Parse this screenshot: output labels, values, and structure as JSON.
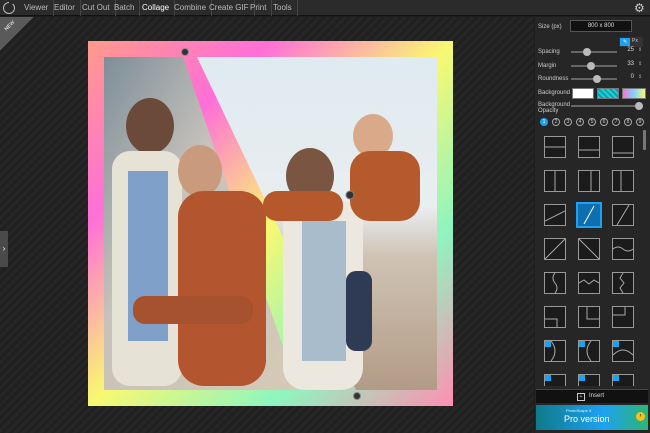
{
  "menu": {
    "items": [
      "Viewer",
      "Editor",
      "Cut Out",
      "Batch",
      "Collage",
      "Combine",
      "Create GIF",
      "Print",
      "Tools"
    ],
    "active": "Collage"
  },
  "canvas": {
    "new_tag": "NEW"
  },
  "panel": {
    "size_label": "Size (px)",
    "size_value": "800 x 800",
    "unit_px": "Px",
    "spacing_label": "Spacing",
    "spacing_value": "25",
    "margin_label": "Margin",
    "margin_value": "33",
    "roundness_label": "Roundness",
    "roundness_value": "0",
    "background_label": "Background",
    "bg_opacity_label_1": "Background",
    "bg_opacity_label_2": "Opacity",
    "pages": [
      "1",
      "2",
      "3",
      "4",
      "5",
      "6",
      "7",
      "8",
      "9"
    ],
    "insert_label": "Insert",
    "pro_small": "PhotoScape X",
    "pro_label": "Pro version"
  },
  "colors": {
    "accent": "#1ea1f2",
    "frame_gradient": [
      "#ff8fb1",
      "#f9f871",
      "#8ef5c0",
      "#ff6fd8",
      "#7ad7ff"
    ]
  }
}
